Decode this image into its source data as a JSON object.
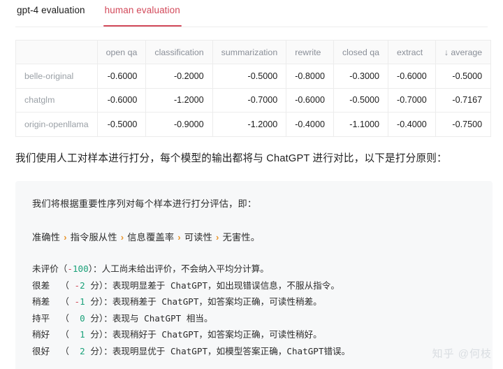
{
  "tabs": [
    {
      "label": "gpt-4 evaluation",
      "active": false
    },
    {
      "label": "human evaluation",
      "active": true
    }
  ],
  "accent_color": "#d2495a",
  "chart_data": {
    "type": "table",
    "title": "human evaluation",
    "columns": [
      "",
      "open qa",
      "classification",
      "summarization",
      "rewrite",
      "closed qa",
      "extract",
      "↓ average"
    ],
    "sort_indicator": {
      "column": "average",
      "direction": "desc",
      "glyph": "↓"
    },
    "row_labels": [
      "belle-original",
      "chatglm",
      "origin-openllama"
    ],
    "categories": [
      "open qa",
      "classification",
      "summarization",
      "rewrite",
      "closed qa",
      "extract",
      "average"
    ],
    "series": [
      {
        "name": "belle-original",
        "values": [
          -0.6,
          -0.2,
          -0.5,
          -0.8,
          -0.3,
          -0.6,
          -0.5
        ]
      },
      {
        "name": "chatglm",
        "values": [
          -0.6,
          -1.2,
          -0.7,
          -0.6,
          -0.5,
          -0.7,
          -0.7167
        ]
      },
      {
        "name": "origin-openllama",
        "values": [
          -0.5,
          -0.9,
          -1.2,
          -0.4,
          -1.1,
          -0.4,
          -0.75
        ]
      }
    ],
    "cells": [
      [
        "belle-original",
        "-0.6000",
        "-0.2000",
        "-0.5000",
        "-0.8000",
        "-0.3000",
        "-0.6000",
        "-0.5000"
      ],
      [
        "chatglm",
        "-0.6000",
        "-1.2000",
        "-0.7000",
        "-0.6000",
        "-0.5000",
        "-0.7000",
        "-0.7167"
      ],
      [
        "origin-openllama",
        "-0.5000",
        "-0.9000",
        "-1.2000",
        "-0.4000",
        "-1.1000",
        "-0.4000",
        "-0.7500"
      ]
    ]
  },
  "intro": "我们使用人工对样本进行打分，每个模型的输出都将与 ChatGPT 进行对比，以下是打分原则：",
  "note": {
    "line1": "我们将根据重要性序列对每个样本进行打分评估，即：",
    "criteria": [
      "准确性",
      "指令服从性",
      "信息覆盖率",
      "可读性",
      "无害性。"
    ],
    "criteria_separator": "›",
    "separator_color": "#e8952c",
    "scores": [
      {
        "label": "未评价",
        "open": "（",
        "minus": "-",
        "value": "100",
        "unit": "）：",
        "desc": "人工尚未给出评价，不会纳入平均分计算。"
      },
      {
        "label": "很差  ",
        "open": "（ ",
        "minus": "-",
        "value": "2",
        "unit": " 分）：",
        "desc": "表现明显差于 ChatGPT，如出现错误信息，不服从指令。"
      },
      {
        "label": "稍差  ",
        "open": "（ ",
        "minus": "-",
        "value": "1",
        "unit": " 分）：",
        "desc": "表现稍差于 ChatGPT，如答案均正确，可读性稍差。"
      },
      {
        "label": "持平  ",
        "open": "（ ",
        "minus": " ",
        "value": "0",
        "unit": " 分）：",
        "desc": "表现与 ChatGPT 相当。"
      },
      {
        "label": "稍好  ",
        "open": "（ ",
        "minus": " ",
        "value": "1",
        "unit": " 分）：",
        "desc": "表现稍好于 ChatGPT，如答案均正确，可读性稍好。"
      },
      {
        "label": "很好  ",
        "open": "（ ",
        "minus": " ",
        "value": "2",
        "unit": " 分）：",
        "desc": "表现明显优于 ChatGPT，如模型答案正确，ChatGPT错误。"
      }
    ]
  },
  "watermark": "知乎 @何枝"
}
